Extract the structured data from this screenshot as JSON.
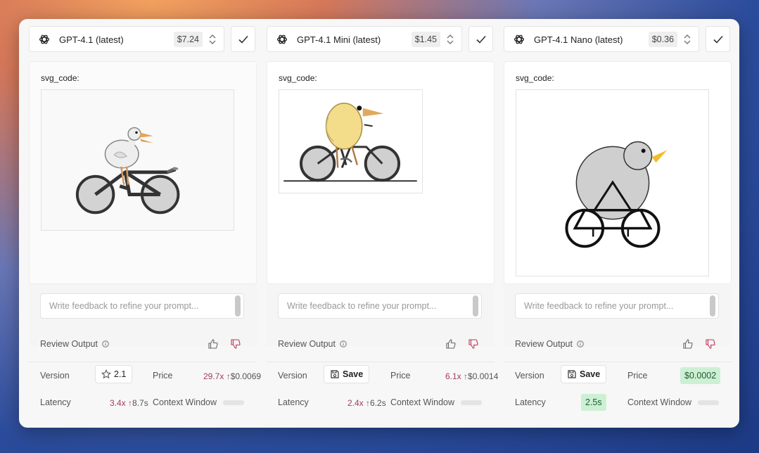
{
  "columns": [
    {
      "model_name": "GPT-4.1 (latest)",
      "price": "$7.24",
      "output_label": "svg_code:",
      "feedback_placeholder": "Write feedback to refine your prompt...",
      "review_label": "Review Output",
      "version_label": "Version",
      "version_value": "2.1",
      "price_label": "Price",
      "price_mult": "29.7x",
      "price_value": "$0.0069",
      "latency_label": "Latency",
      "latency_mult": "3.4x",
      "latency_value": "8.7s",
      "context_label": "Context Window"
    },
    {
      "model_name": "GPT-4.1 Mini (latest)",
      "price": "$1.45",
      "output_label": "svg_code:",
      "feedback_placeholder": "Write feedback to refine your prompt...",
      "review_label": "Review Output",
      "version_label": "Version",
      "version_value": "Save",
      "price_label": "Price",
      "price_mult": "6.1x",
      "price_value": "$0.0014",
      "latency_label": "Latency",
      "latency_mult": "2.4x",
      "latency_value": "6.2s",
      "context_label": "Context Window"
    },
    {
      "model_name": "GPT-4.1 Nano (latest)",
      "price": "$0.36",
      "output_label": "svg_code:",
      "feedback_placeholder": "Write feedback to refine your prompt...",
      "review_label": "Review Output",
      "version_label": "Version",
      "version_value": "Save",
      "price_label": "Price",
      "price_value": "$0.0002",
      "latency_label": "Latency",
      "latency_value": "2.5s",
      "context_label": "Context Window"
    }
  ],
  "icons": {
    "model_logo": "openai-logo-icon",
    "stepper": "chevron-up-down-icon",
    "select": "check-icon",
    "info": "info-icon",
    "thumbs_up": "thumbs-up-icon",
    "thumbs_down": "thumbs-down-icon",
    "star": "star-icon",
    "save": "floppy-disk-icon",
    "arrow": "arrow-up-icon"
  },
  "colors": {
    "accent_red": "#a33c5a",
    "success_bg": "#cdf0d4",
    "success_text": "#1e5c2d"
  }
}
